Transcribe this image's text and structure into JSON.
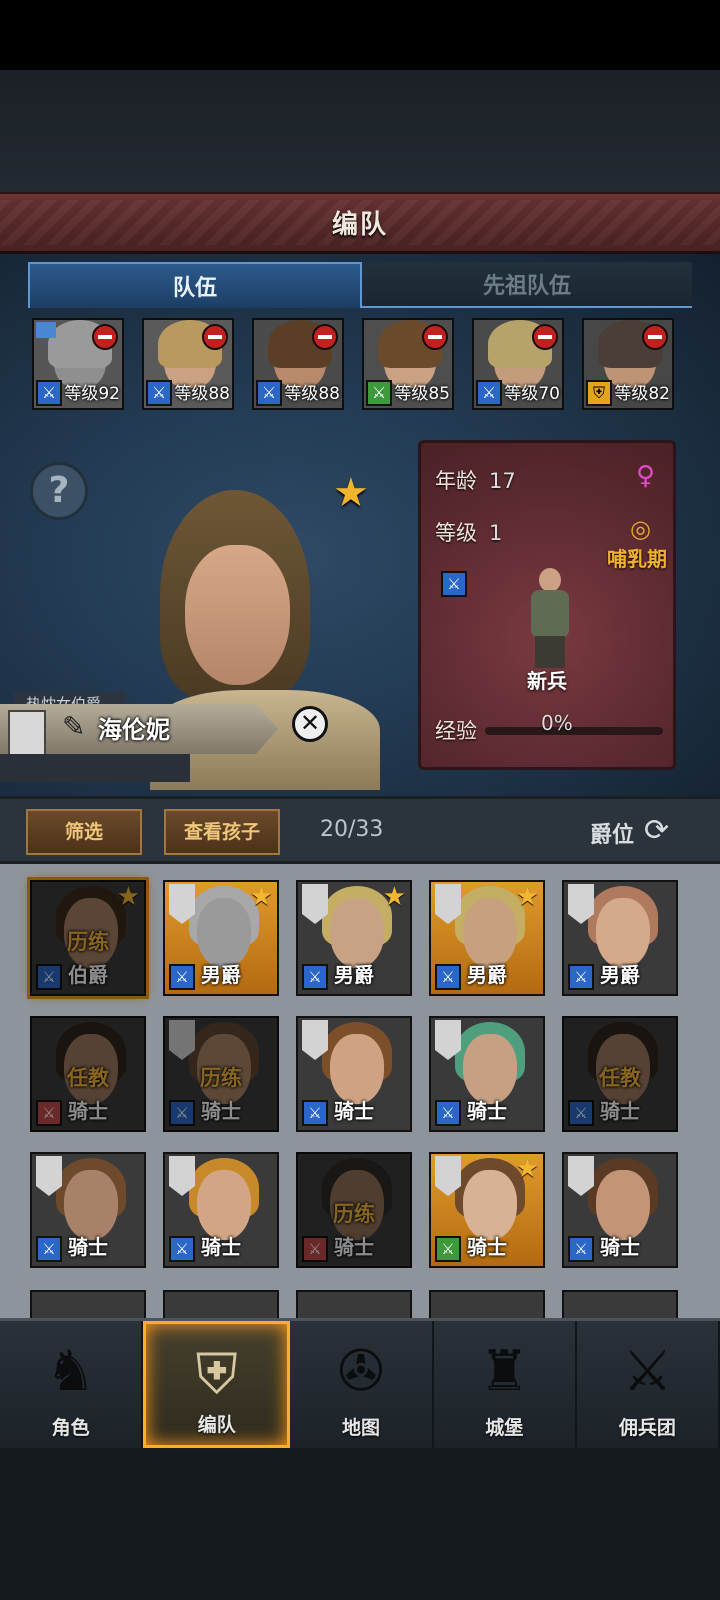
{
  "screen_title": "编队",
  "tabs": [
    {
      "label": "队伍",
      "active": true
    },
    {
      "label": "先祖队伍",
      "active": false
    }
  ],
  "squad": [
    {
      "level": "等级92",
      "class_icon": "sword-icon",
      "class_color": "blue",
      "hair": "#9a9a9a",
      "face": "#8f8f8f",
      "bg": "#565656",
      "flag": true
    },
    {
      "level": "等级88",
      "class_icon": "sword-icon",
      "class_color": "blue",
      "hair": "#b89a5e",
      "face": "#caa183",
      "bg": "#5a5a5a",
      "flag": false
    },
    {
      "level": "等级88",
      "class_icon": "sword-icon",
      "class_color": "blue",
      "hair": "#5a3f26",
      "face": "#b88a6b",
      "bg": "#4b4b4b",
      "flag": false
    },
    {
      "level": "等级85",
      "class_icon": "sword-icon",
      "class_color": "green",
      "hair": "#6b4a2c",
      "face": "#caa183",
      "bg": "#4e4e4e",
      "flag": false
    },
    {
      "level": "等级70",
      "class_icon": "sword-icon",
      "class_color": "blue",
      "hair": "#b6a36a",
      "face": "#c39c7c",
      "bg": "#4a4a4a",
      "flag": false
    },
    {
      "level": "等级82",
      "class_icon": "shield-icon",
      "class_color": "gold",
      "hair": "#4a3e36",
      "face": "#bf9476",
      "bg": "#474747",
      "flag": false
    }
  ],
  "hero": {
    "title": "热忱女伯爵",
    "name": "海伦妮",
    "age_label": "年龄",
    "age": "17",
    "level_label": "等级",
    "level": "1",
    "stage": "哺乳期",
    "soldier_class": "新兵",
    "exp_label": "经验",
    "exp_value": "0%",
    "exp_progress": 0
  },
  "toolbar": {
    "filter_label": "筛选",
    "children_label": "查看孩子",
    "count": "20/33",
    "sort_label": "爵位"
  },
  "roster": [
    {
      "rank": "伯爵",
      "status": "历练",
      "star": true,
      "banner": false,
      "class_color": "blue",
      "card": "dark",
      "dim": true,
      "selected": true,
      "hair": "#3b2a1c",
      "face": "#a47d62"
    },
    {
      "rank": "男爵",
      "status": "",
      "star": true,
      "banner": true,
      "class_color": "blue",
      "card": "gold",
      "dim": false,
      "selected": false,
      "hair": "#a8a8a8",
      "face": "#9a9a9a"
    },
    {
      "rank": "男爵",
      "status": "",
      "star": true,
      "banner": true,
      "class_color": "blue",
      "card": "dark",
      "dim": false,
      "selected": false,
      "hair": "#c3ae64",
      "face": "#c8a284"
    },
    {
      "rank": "男爵",
      "status": "",
      "star": true,
      "banner": true,
      "class_color": "blue",
      "card": "gold",
      "dim": false,
      "selected": false,
      "hair": "#c3ae64",
      "face": "#c7a07e"
    },
    {
      "rank": "男爵",
      "status": "",
      "star": false,
      "banner": true,
      "class_color": "blue",
      "card": "dark",
      "dim": false,
      "selected": false,
      "hair": "#b07a5e",
      "face": "#d5a98b"
    },
    {
      "rank": "骑士",
      "status": "任教",
      "star": false,
      "banner": false,
      "class_color": "red",
      "card": "dark",
      "dim": true,
      "selected": false,
      "hair": "#2e241c",
      "face": "#9c785e"
    },
    {
      "rank": "骑士",
      "status": "历练",
      "star": false,
      "banner": true,
      "class_color": "blue",
      "card": "dark",
      "dim": true,
      "selected": false,
      "hair": "#5e4530",
      "face": "#a98264"
    },
    {
      "rank": "骑士",
      "status": "",
      "star": false,
      "banner": true,
      "class_color": "blue",
      "card": "dark",
      "dim": false,
      "selected": false,
      "hair": "#7c4e2a",
      "face": "#cfa284"
    },
    {
      "rank": "骑士",
      "status": "",
      "star": false,
      "banner": true,
      "class_color": "blue",
      "card": "dark",
      "dim": false,
      "selected": false,
      "hair": "#4f9e7e",
      "face": "#c7a084"
    },
    {
      "rank": "骑士",
      "status": "任教",
      "star": false,
      "banner": false,
      "class_color": "blue",
      "card": "dark",
      "dim": true,
      "selected": false,
      "hair": "#2e241c",
      "face": "#9c785e"
    },
    {
      "rank": "骑士",
      "status": "",
      "star": false,
      "banner": true,
      "class_color": "blue",
      "card": "dark",
      "dim": false,
      "selected": false,
      "hair": "#6e4a2c",
      "face": "#a88268"
    },
    {
      "rank": "骑士",
      "status": "",
      "star": false,
      "banner": true,
      "class_color": "blue",
      "card": "dark",
      "dim": false,
      "selected": false,
      "hair": "#c8892a",
      "face": "#d2a584"
    },
    {
      "rank": "骑士",
      "status": "历练",
      "star": false,
      "banner": false,
      "class_color": "red",
      "card": "dark",
      "dim": true,
      "selected": false,
      "hair": "#2c2a26",
      "face": "#8f7058"
    },
    {
      "rank": "骑士",
      "status": "",
      "star": true,
      "banner": true,
      "class_color": "green",
      "card": "gold",
      "dim": false,
      "selected": false,
      "hair": "#6e4a2c",
      "face": "#d8b294"
    },
    {
      "rank": "骑士",
      "status": "",
      "star": false,
      "banner": true,
      "class_color": "blue",
      "card": "dark",
      "dim": false,
      "selected": false,
      "hair": "#5a3a22",
      "face": "#c39476"
    }
  ],
  "nav": [
    {
      "label": "角色",
      "glyph": "♞",
      "active": false
    },
    {
      "label": "编队",
      "glyph": "⛨",
      "active": true
    },
    {
      "label": "地图",
      "glyph": "✇",
      "active": false
    },
    {
      "label": "城堡",
      "glyph": "♜",
      "active": false
    },
    {
      "label": "佣兵团",
      "glyph": "⚔",
      "active": false
    }
  ]
}
